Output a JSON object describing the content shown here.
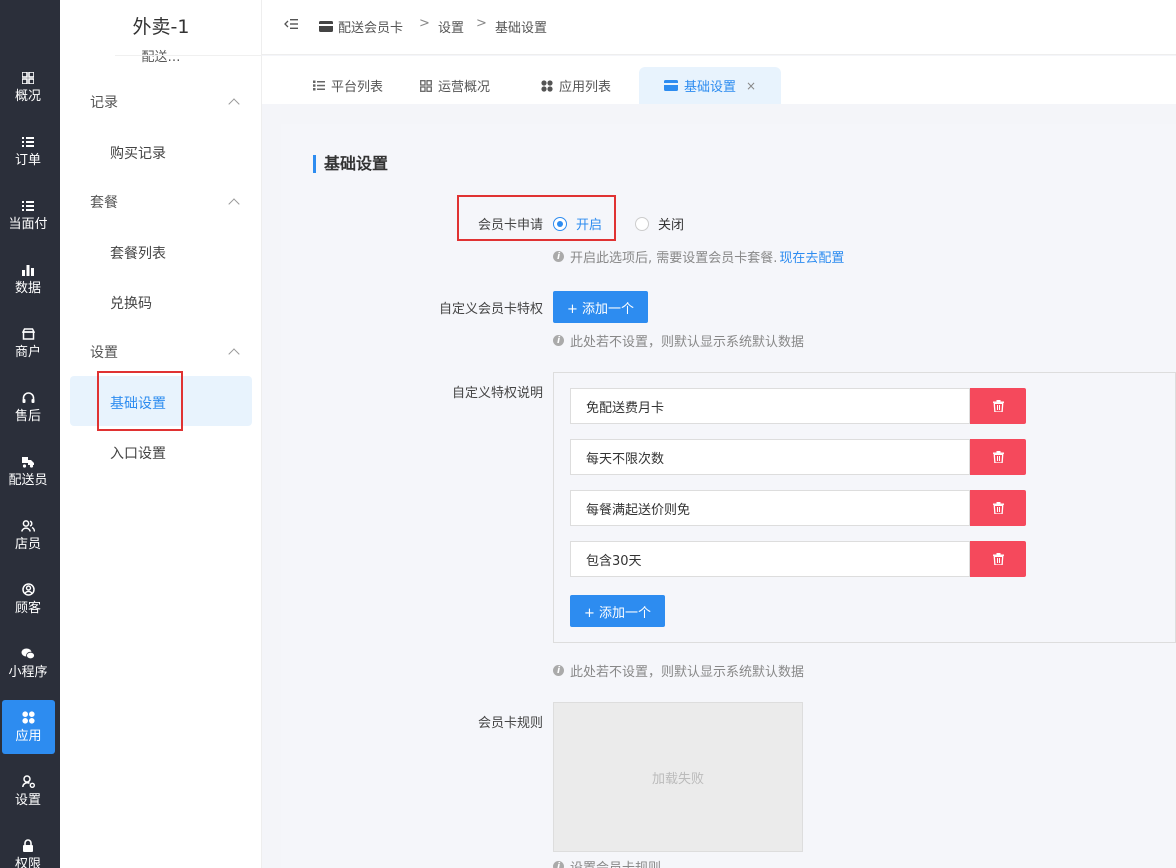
{
  "rail": {
    "items": [
      {
        "label": "概况",
        "icon": "dashboard-icon"
      },
      {
        "label": "订单",
        "icon": "list-icon"
      },
      {
        "label": "当面付",
        "icon": "list-icon"
      },
      {
        "label": "数据",
        "icon": "bar-chart-icon"
      },
      {
        "label": "商户",
        "icon": "store-icon"
      },
      {
        "label": "售后",
        "icon": "headset-icon"
      },
      {
        "label": "配送员",
        "icon": "delivery-icon"
      },
      {
        "label": "店员",
        "icon": "staff-icon"
      },
      {
        "label": "顾客",
        "icon": "customer-icon"
      },
      {
        "label": "小程序",
        "icon": "wechat-icon"
      },
      {
        "label": "应用",
        "icon": "apps-icon"
      },
      {
        "label": "设置",
        "icon": "settings-user-icon"
      },
      {
        "label": "权限",
        "icon": "lock-icon"
      }
    ],
    "active": "应用"
  },
  "sidebar": {
    "store_name": "外卖-1",
    "store_sub": "配送…",
    "groups": [
      {
        "label": "记录",
        "items": [
          "购买记录"
        ]
      },
      {
        "label": "套餐",
        "items": [
          "套餐列表",
          "兑换码"
        ]
      },
      {
        "label": "设置",
        "items": [
          "基础设置",
          "入口设置"
        ]
      }
    ],
    "active_item": "基础设置"
  },
  "breadcrumb": {
    "items": [
      "配送会员卡",
      "设置",
      "基础设置"
    ],
    "separator": ">"
  },
  "tabs": [
    {
      "label": "平台列表",
      "icon": "list-icon"
    },
    {
      "label": "运营概况",
      "icon": "dashboard-icon"
    },
    {
      "label": "应用列表",
      "icon": "apps-icon"
    },
    {
      "label": "基础设置",
      "icon": "card-icon",
      "active": true,
      "close": "×"
    }
  ],
  "form": {
    "section_title": "基础设置",
    "apply": {
      "label": "会员卡申请",
      "options": [
        "开启",
        "关闭"
      ],
      "selected": "开启",
      "hint": "开启此选项后, 需要设置会员卡套餐.",
      "hint_link": "现在去配置"
    },
    "privilege": {
      "label": "自定义会员卡特权",
      "button": "+ 添加一个",
      "hint": "此处若不设置，则默认显示系统默认数据"
    },
    "privilege_desc": {
      "label": "自定义特权说明",
      "items": [
        "免配送费月卡",
        "每天不限次数",
        "每餐满起送价则免",
        "包含30天"
      ],
      "button": "+ 添加一个",
      "hint": "此处若不设置，则默认显示系统默认数据"
    },
    "rules": {
      "label": "会员卡规则",
      "image_text": "加载失败",
      "hint": "设置会员卡规则"
    }
  },
  "colors": {
    "accent": "#2d8cf0",
    "danger": "#f5495c",
    "rail_bg": "#2b2f3a",
    "highlight_box": "#e03232"
  }
}
